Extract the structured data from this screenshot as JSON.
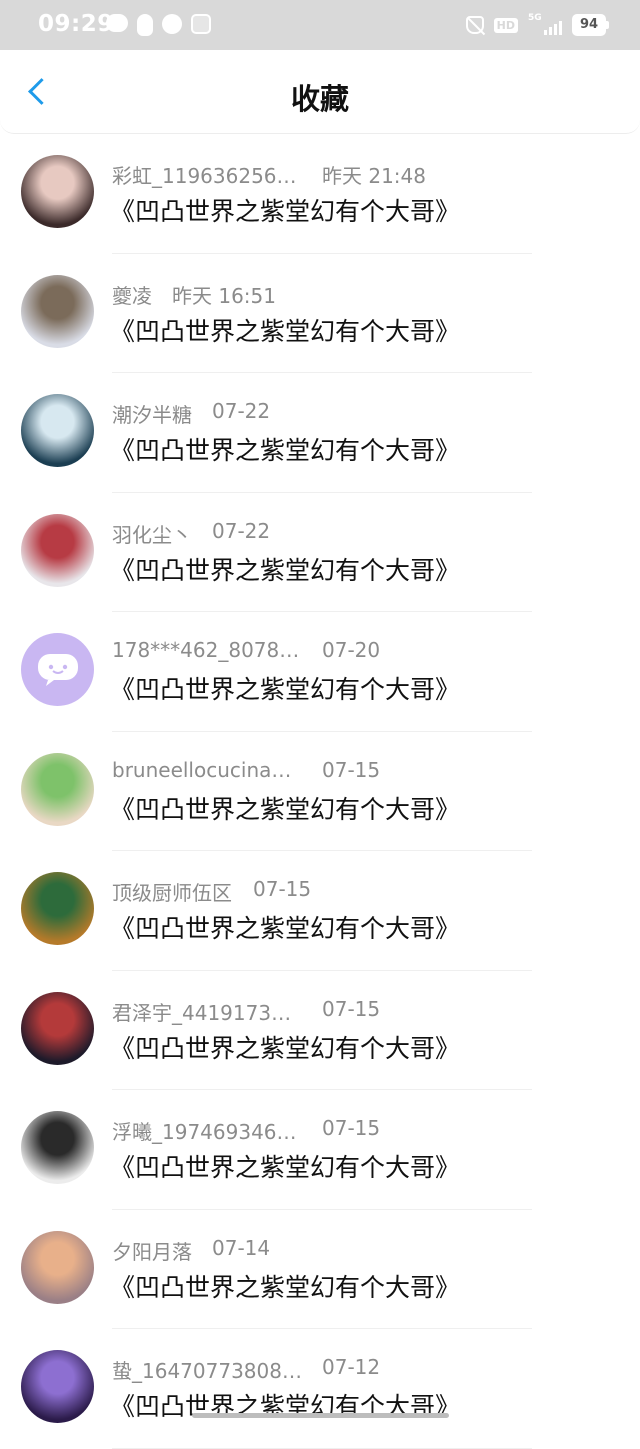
{
  "status_bar": {
    "time": "09:29",
    "network": "5G",
    "hd": "HD",
    "battery": "94"
  },
  "header": {
    "title": "收藏"
  },
  "items": [
    {
      "user": "彩虹_119636256…",
      "time": "昨天 21:48",
      "title": "《凹凸世界之紫堂幻有个大哥》",
      "avatar_colors": [
        "#3b2a2a",
        "#e7c9c1"
      ]
    },
    {
      "user": "夔凌",
      "time": "昨天 16:51",
      "title": "《凹凸世界之紫堂幻有个大哥》",
      "avatar_colors": [
        "#d9dce6",
        "#7b6b5a"
      ]
    },
    {
      "user": "潮汐半糖",
      "time": "07-22",
      "title": "《凹凸世界之紫堂幻有个大哥》",
      "avatar_colors": [
        "#1b3e52",
        "#d7e8f0"
      ]
    },
    {
      "user": "羽化尘丶",
      "time": "07-22",
      "title": "《凹凸世界之紫堂幻有个大哥》",
      "avatar_colors": [
        "#e8e6ea",
        "#b73b44"
      ]
    },
    {
      "user": "178***462_8078…",
      "time": "07-20",
      "title": "《凹凸世界之紫堂幻有个大哥》",
      "avatar_colors": [
        "#c9b7f2",
        "#ffffff"
      ]
    },
    {
      "user": "bruneellocucina…",
      "time": "07-15",
      "title": "《凹凸世界之紫堂幻有个大哥》",
      "avatar_colors": [
        "#e9d8c4",
        "#7ec26a"
      ]
    },
    {
      "user": "顶级厨师伍区",
      "time": "07-15",
      "title": "《凹凸世界之紫堂幻有个大哥》",
      "avatar_colors": [
        "#b57a2a",
        "#2d6b3b"
      ]
    },
    {
      "user": "君泽宇_4419173…",
      "time": "07-15",
      "title": "《凹凸世界之紫堂幻有个大哥》",
      "avatar_colors": [
        "#1d1a2a",
        "#b43a3a"
      ]
    },
    {
      "user": "浮曦_197469346…",
      "time": "07-15",
      "title": "《凹凸世界之紫堂幻有个大哥》",
      "avatar_colors": [
        "#ececec",
        "#2a2a2a"
      ]
    },
    {
      "user": "夕阳月落",
      "time": "07-14",
      "title": "《凹凸世界之紫堂幻有个大哥》",
      "avatar_colors": [
        "#9a7f86",
        "#e8b08a"
      ]
    },
    {
      "user": "蛰_16470773808…",
      "time": "07-12",
      "title": "《凹凸世界之紫堂幻有个大哥》",
      "avatar_colors": [
        "#2b1b4a",
        "#8d6fd1"
      ]
    }
  ]
}
